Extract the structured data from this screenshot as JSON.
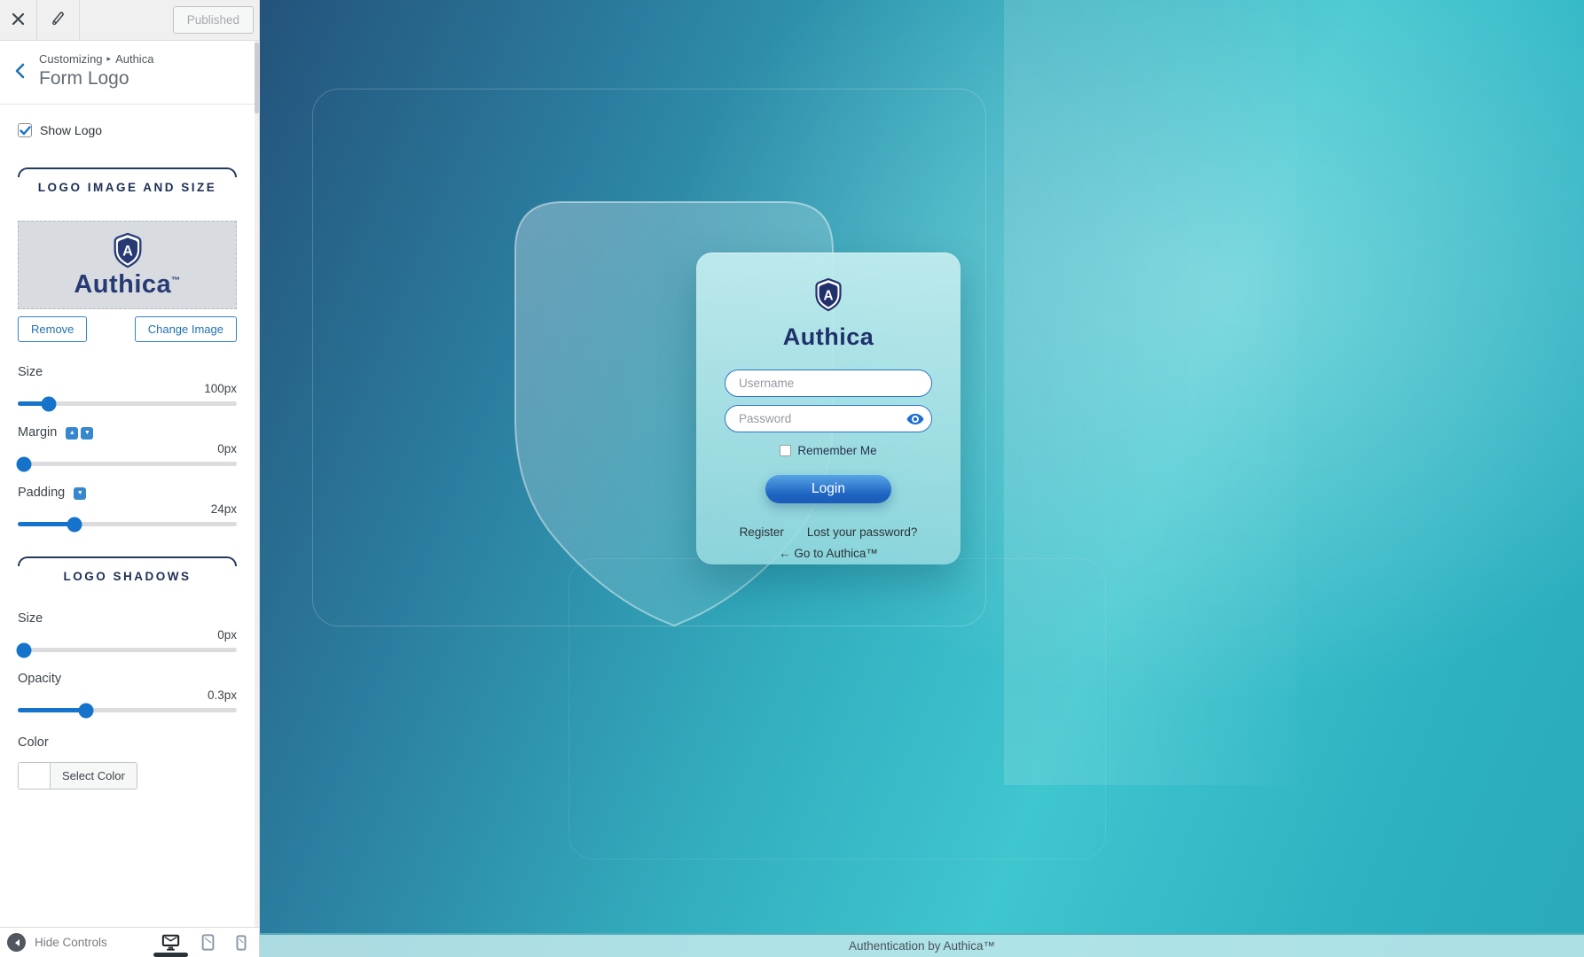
{
  "topbar": {
    "published_label": "Published"
  },
  "sidebar": {
    "breadcrumb": {
      "level1": "Customizing",
      "separator": "▸",
      "level2": "Authica"
    },
    "title": "Form Logo",
    "show_logo_label": "Show Logo",
    "logo_section": {
      "heading": "LOGO IMAGE AND SIZE",
      "brand": "Authica",
      "tm": "™",
      "remove_label": "Remove",
      "change_image_label": "Change Image",
      "size": {
        "label": "Size",
        "value": "100px",
        "percent": 14
      },
      "margin": {
        "label": "Margin",
        "value": "0px",
        "percent": 3
      },
      "padding": {
        "label": "Padding",
        "value": "24px",
        "percent": 26
      }
    },
    "shadow_section": {
      "heading": "LOGO SHADOWS",
      "size": {
        "label": "Size",
        "value": "0px",
        "percent": 3
      },
      "opacity": {
        "label": "Opacity",
        "value": "0.3px",
        "percent": 31
      },
      "color": {
        "label": "Color",
        "button_label": "Select Color"
      }
    },
    "bottom": {
      "hide_controls_label": "Hide Controls"
    }
  },
  "preview": {
    "card": {
      "brand": "Authica",
      "username_placeholder": "Username",
      "password_placeholder": "Password",
      "remember_label": "Remember Me",
      "login_label": "Login",
      "register_label": "Register",
      "lost_password_label": "Lost your password?",
      "back_link_label": "← Go to Authica™"
    },
    "footer_text": "Authentication by Authica™"
  },
  "icons": {
    "logo_letter": "A",
    "margin_up": "▲",
    "margin_down": "▼",
    "padding_down": "▼",
    "collapse_arrow": "◀"
  },
  "colors": {
    "accent_blue": "#2271b1",
    "slider_blue": "#1673cc",
    "brand_navy": "#273a74",
    "section_navy": "#1d2f55",
    "login_gradient_top": "#57a3e6",
    "login_gradient_bottom": "#1b5cb8",
    "background_navy": "#24537b",
    "background_teal": "#3fc6cf"
  }
}
